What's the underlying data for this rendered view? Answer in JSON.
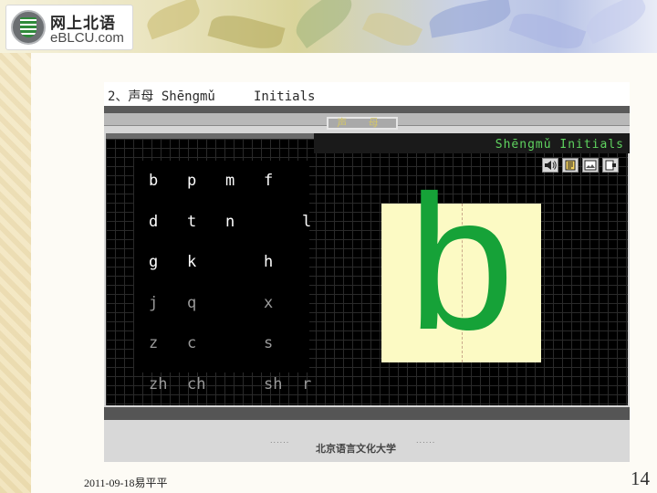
{
  "banner": {
    "logo_cn": "网上北语",
    "logo_en": "eBLCU.com"
  },
  "screenshot": {
    "title": "2、声母 Shēngmǔ     Initials",
    "tab_label": "声 母",
    "panel_title": "Shēngmǔ Initials",
    "toolbar_icons": [
      "speaker-icon",
      "book-icon",
      "image-icon",
      "exit-icon"
    ],
    "initials_rows": [
      {
        "cells": [
          "b",
          "p",
          "m",
          "f",
          ""
        ],
        "style": "bright"
      },
      {
        "cells": [
          "d",
          "t",
          "n",
          "",
          "l"
        ],
        "style": "bright"
      },
      {
        "cells": [
          "g",
          "k",
          "",
          "h",
          ""
        ],
        "style": "bright"
      },
      {
        "cells": [
          "j",
          "q",
          "",
          "x",
          ""
        ],
        "style": "dim"
      },
      {
        "cells": [
          "z",
          "c",
          "",
          "s",
          ""
        ],
        "style": "dim"
      },
      {
        "cells": [
          "zh",
          "ch",
          "",
          "sh",
          "r"
        ],
        "style": "dim"
      }
    ],
    "display_letter": "b",
    "display_letter_color": "#16a238",
    "footer_org": "北京语言文化大学",
    "footer_left_dots": "......",
    "footer_right_dots": "......"
  },
  "slide": {
    "date_author": "2011-09-18易平平",
    "page_number": "14"
  }
}
